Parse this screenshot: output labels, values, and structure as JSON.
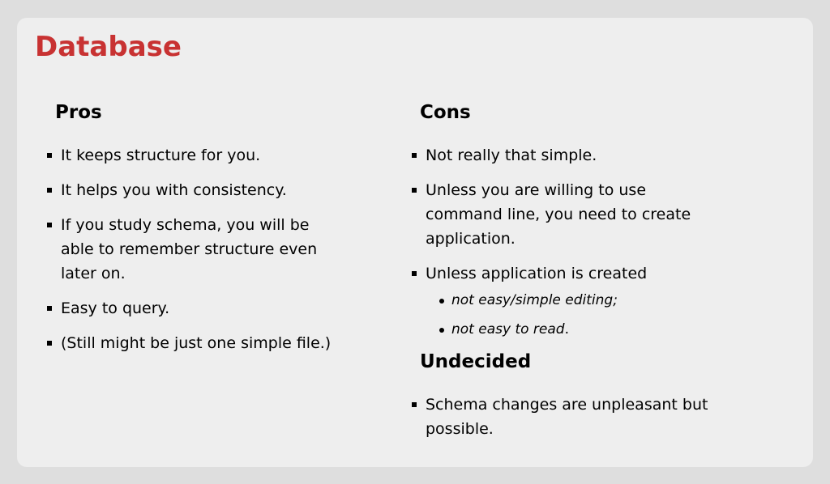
{
  "title": "Database",
  "pros": {
    "heading": "Pros",
    "items": [
      "It keeps structure for you.",
      "It helps you with consistency.",
      "If you study schema, you will be able to remember structure even later on.",
      "Easy to query.",
      "(Still might be just one simple file.)"
    ]
  },
  "cons": {
    "heading": "Cons",
    "items": [
      "Not really that simple.",
      "Unless you are willing to use command line, you need to create application.",
      "Unless application is created"
    ],
    "subitems": [
      "not easy/simple editing;",
      "not easy to read"
    ],
    "subitem_suffix": "."
  },
  "undecided": {
    "heading": "Undecided",
    "items": [
      "Schema changes are unpleasant but possible."
    ]
  }
}
